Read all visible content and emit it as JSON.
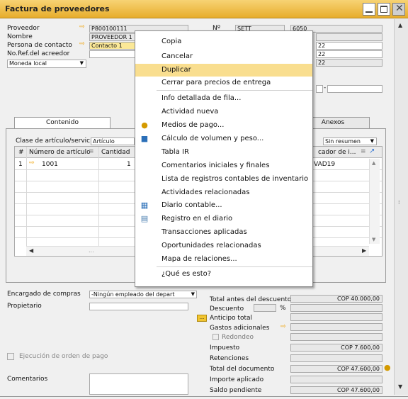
{
  "window": {
    "title": "Factura de proveedores"
  },
  "header": {
    "proveedor_label": "Proveedor",
    "proveedor_value": "P800100111",
    "nombre_label": "Nombre",
    "nombre_value": "PROVEEDOR 1",
    "contacto_label": "Persona de contacto",
    "contacto_value": "Contacto 1",
    "noref_label": "No.Ref.del acreedor",
    "moneda_value": "Moneda local",
    "no_label": "Nº",
    "serie_value": "SETT",
    "numero_value": "6050",
    "date_frag_1": "22",
    "date_frag_2": "22",
    "date_frag_3": "22"
  },
  "tabs": {
    "contenido": "Contenido",
    "anexos": "Anexos"
  },
  "content": {
    "clase_label": "Clase de artículo/servicio",
    "clase_value": "Artículo",
    "resumen_value": "Sin resumen",
    "col_hash": "#",
    "col_item": "Número de artículo",
    "col_qty": "Cantidad",
    "col_tax": "cador de i...",
    "row1_num": "1",
    "row1_item": "1001",
    "row1_qty": "1",
    "row1_tax": "VAD19",
    "scroll_dots": "..."
  },
  "context_menu": {
    "items": [
      "Copia",
      "Cancelar",
      "Duplicar",
      "Cerrar para precios de entrega",
      "Info detallada de fila...",
      "Actividad nueva",
      "Medios de pago...",
      "Cálculo de volumen y peso...",
      "Tabla IR",
      "Comentarios iniciales y finales",
      "Lista de registros contables de inventario",
      "Actividades relacionadas",
      "Diario contable...",
      "Registro en el diario",
      "Transacciones aplicadas",
      "Oportunidades relacionadas",
      "Mapa de relaciones...",
      "¿Qué es esto?"
    ]
  },
  "footer": {
    "encargado_label": "Encargado de compras",
    "encargado_value": "-Ningún empleado del depart",
    "propietario_label": "Propietario",
    "ejecucion_label": "Ejecución de orden de pago",
    "comentarios_label": "Comentarios"
  },
  "totals": {
    "total_antes_label": "Total antes del descuento",
    "total_antes_value": "COP 40.000,00",
    "descuento_label": "Descuento",
    "pct": "%",
    "anticipo_label": "Anticipo total",
    "gastos_label": "Gastos adicionales",
    "redondeo_label": "Redondeo",
    "impuesto_label": "Impuesto",
    "impuesto_value": "COP 7.600,00",
    "retenciones_label": "Retenciones",
    "total_doc_label": "Total del documento",
    "total_doc_value": "COP 47.600,00",
    "importe_label": "Importe aplicado",
    "saldo_label": "Saldo pendiente",
    "saldo_value": "COP 47.600,00",
    "dots_btn": "..."
  }
}
